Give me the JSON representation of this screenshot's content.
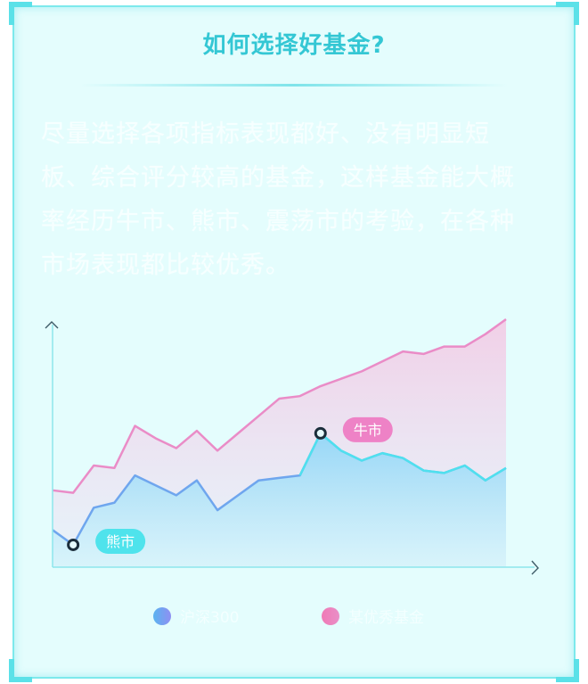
{
  "header": {
    "title": "如何选择好基金?"
  },
  "body_text": "尽量选择各项指标表现都好、没有明显短板、综合评分较高的基金，这样基金能大概率经历牛市、熊市、震荡市的考验，在各种市场表现都比较优秀。",
  "chart_data": {
    "type": "area",
    "series": [
      {
        "name": "沪深300",
        "color": "#6fa6ee",
        "values": [
          15,
          9,
          24,
          26,
          37,
          33,
          29,
          35,
          23,
          29,
          35,
          36,
          37,
          54,
          47,
          43,
          46,
          44,
          39,
          38,
          41,
          35,
          40
        ]
      },
      {
        "name": "优秀基金",
        "color": "#ea8cc7",
        "values": [
          31,
          30,
          41,
          40,
          57,
          52,
          48,
          55,
          47,
          54,
          61,
          68,
          69,
          73,
          76,
          79,
          83,
          87,
          86,
          89,
          89,
          94,
          100
        ]
      }
    ],
    "annotations": [
      {
        "label": "熊市",
        "series": 0,
        "index": 1
      },
      {
        "label": "牛市",
        "series": 0,
        "index": 13
      }
    ],
    "ylim": [
      0,
      100
    ],
    "legend": "bottom"
  },
  "legend": [
    {
      "label": "沪深300",
      "colors": [
        "#5ab4f0",
        "#8f8ff2"
      ]
    },
    {
      "label": "某优秀基金",
      "colors": [
        "#f07ab6",
        "#e98fc7"
      ]
    }
  ]
}
